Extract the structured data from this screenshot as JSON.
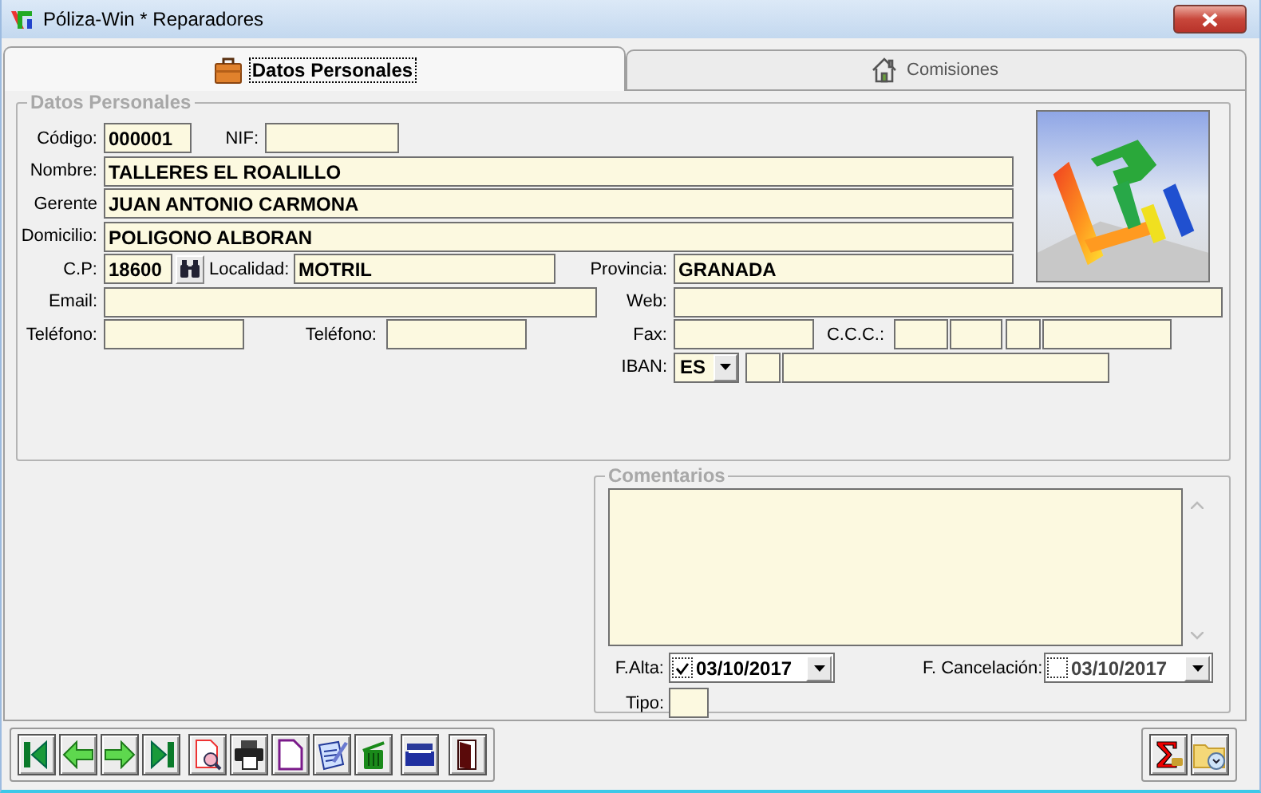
{
  "window": {
    "title": "Póliza-Win * Reparadores"
  },
  "tabs": [
    {
      "label": "Datos Personales",
      "selected": true
    },
    {
      "label": "Comisiones",
      "selected": false
    }
  ],
  "datos_personales": {
    "legend": "Datos Personales",
    "fields": [
      {
        "kind": "text",
        "label": "Código:",
        "value": "000001"
      },
      {
        "kind": "text",
        "label": "NIF:"
      },
      {
        "kind": "text",
        "label": "Nombre:",
        "value": "TALLERES EL ROALILLO"
      },
      {
        "kind": "text",
        "label": "Gerente",
        "value": "JUAN ANTONIO CARMONA"
      },
      {
        "kind": "text",
        "label": "Domicilio:",
        "value": "POLIGONO ALBORAN"
      },
      {
        "kind": "lookup",
        "label": "C.P:",
        "value": "18600"
      },
      {
        "kind": "text",
        "label": "Localidad:",
        "value": "MOTRIL"
      },
      {
        "kind": "text",
        "label": "Provincia:",
        "value": "GRANADA"
      },
      {
        "kind": "text",
        "label": "Email:"
      },
      {
        "kind": "text",
        "label": "Web:"
      },
      {
        "kind": "text",
        "label": "Teléfono:"
      },
      {
        "kind": "text",
        "label": "Teléfono:"
      },
      {
        "kind": "text",
        "label": "Fax:"
      },
      {
        "kind": "segmented",
        "label": "C.C.C.:"
      },
      {
        "kind": "combo",
        "label": "IBAN:",
        "value": "ES"
      }
    ]
  },
  "comentarios": {
    "legend": "Comentarios",
    "dates": [
      {
        "label": "F.Alta:",
        "value": "03/10/2017",
        "checked": true
      },
      {
        "label": "F. Cancelación:",
        "value": "03/10/2017",
        "checked": false
      }
    ],
    "tipo": {
      "label": "Tipo:"
    }
  }
}
